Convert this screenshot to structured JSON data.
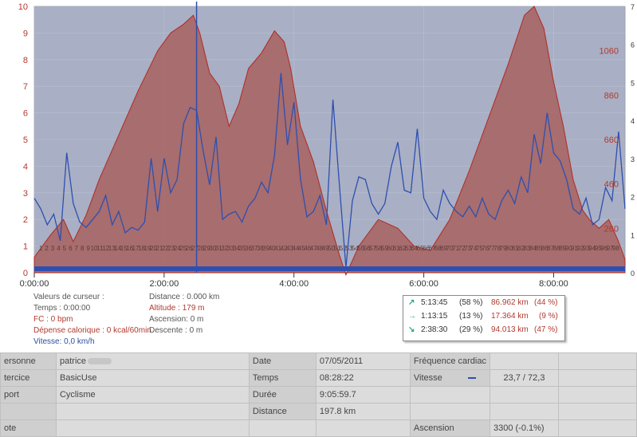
{
  "chart_data": {
    "type": "area",
    "x_ticks": [
      "0:00:00",
      "2:00:00",
      "4:00:00",
      "6:00:00",
      "8:00:00"
    ],
    "y_left_ticks": [
      "0",
      "1",
      "2",
      "3",
      "4",
      "5",
      "6",
      "7",
      "8",
      "9",
      "10"
    ],
    "y_right_ticks": [
      "0",
      "1",
      "2",
      "3",
      "4",
      "5",
      "6",
      "7"
    ],
    "altitude_ticks": [
      "260",
      "460",
      "660",
      "860",
      "1060"
    ],
    "x_range_hours": [
      0,
      9.1
    ],
    "y_left_range": [
      0,
      10
    ],
    "altitude_range_m": [
      60,
      1260
    ],
    "cursor_time": "2:30:00",
    "km_markers": [
      "1",
      "2",
      "3",
      "4",
      "5",
      "6",
      "7",
      "8",
      "9",
      "10",
      "11",
      "12",
      "13",
      "14",
      "15",
      "16",
      "17",
      "18",
      "19",
      "20",
      "21",
      "22",
      "23",
      "24",
      "25",
      "26",
      "27",
      "28",
      "29",
      "30",
      "31",
      "32",
      "33",
      "34",
      "35",
      "36",
      "37",
      "38",
      "39",
      "40",
      "41",
      "42",
      "43",
      "44",
      "45",
      "46",
      "47",
      "48",
      "49",
      "50",
      "51",
      "52",
      "53",
      "54",
      "55",
      "56",
      "57",
      "58",
      "59",
      "60",
      "61",
      "62",
      "63",
      "64",
      "65",
      "66",
      "67",
      "68",
      "69",
      "70",
      "71",
      "72",
      "73",
      "74",
      "75",
      "76",
      "77",
      "78",
      "79",
      "80",
      "81",
      "82",
      "83",
      "84",
      "85",
      "86",
      "87",
      "88",
      "89",
      "90",
      "91",
      "92",
      "93",
      "94",
      "95",
      "96",
      "97",
      "98"
    ],
    "altitude_series": {
      "x": [
        0,
        0.25,
        0.45,
        0.6,
        0.8,
        1.0,
        1.3,
        1.6,
        1.9,
        2.1,
        2.3,
        2.45,
        2.55,
        2.7,
        2.85,
        3.0,
        3.15,
        3.3,
        3.5,
        3.7,
        3.85,
        3.95,
        4.1,
        4.3,
        4.5,
        4.7,
        4.8,
        5.0,
        5.3,
        5.6,
        5.85,
        6.1,
        6.4,
        6.7,
        7.0,
        7.3,
        7.55,
        7.7,
        7.85,
        8.0,
        8.15,
        8.3,
        8.45,
        8.55,
        8.7,
        8.85,
        9.0,
        9.1
      ],
      "altitude_m": [
        130,
        230,
        300,
        200,
        320,
        480,
        680,
        880,
        1060,
        1140,
        1180,
        1220,
        1140,
        960,
        900,
        720,
        820,
        980,
        1050,
        1150,
        1100,
        980,
        720,
        560,
        340,
        140,
        50,
        180,
        300,
        260,
        180,
        160,
        300,
        520,
        760,
        1000,
        1220,
        1260,
        1160,
        920,
        720,
        480,
        340,
        300,
        260,
        300,
        200,
        120
      ]
    },
    "speed_series": {
      "x": [
        0,
        0.1,
        0.2,
        0.3,
        0.4,
        0.5,
        0.6,
        0.7,
        0.8,
        0.9,
        1.0,
        1.1,
        1.2,
        1.3,
        1.4,
        1.5,
        1.6,
        1.7,
        1.8,
        1.9,
        2.0,
        2.1,
        2.2,
        2.3,
        2.4,
        2.5,
        2.6,
        2.7,
        2.8,
        2.9,
        3.0,
        3.1,
        3.2,
        3.3,
        3.4,
        3.5,
        3.6,
        3.7,
        3.8,
        3.9,
        4.0,
        4.1,
        4.2,
        4.3,
        4.4,
        4.5,
        4.6,
        4.7,
        4.8,
        4.9,
        5.0,
        5.1,
        5.2,
        5.3,
        5.4,
        5.5,
        5.6,
        5.7,
        5.8,
        5.9,
        6.0,
        6.1,
        6.2,
        6.3,
        6.4,
        6.5,
        6.6,
        6.7,
        6.8,
        6.9,
        7.0,
        7.1,
        7.2,
        7.3,
        7.4,
        7.5,
        7.6,
        7.7,
        7.8,
        7.9,
        8.0,
        8.1,
        8.2,
        8.3,
        8.4,
        8.5,
        8.6,
        8.7,
        8.8,
        8.9,
        9.0,
        9.1
      ],
      "values": [
        2.8,
        2.4,
        1.8,
        2.2,
        1.2,
        4.5,
        2.6,
        1.9,
        1.7,
        2.0,
        2.3,
        2.9,
        1.8,
        2.3,
        1.5,
        1.7,
        1.6,
        1.9,
        4.3,
        2.3,
        4.3,
        3.0,
        3.5,
        5.6,
        6.2,
        6.1,
        4.6,
        3.3,
        5.1,
        2.0,
        2.2,
        2.3,
        1.9,
        2.5,
        2.8,
        3.4,
        3.0,
        4.4,
        7.5,
        4.8,
        6.4,
        3.5,
        2.1,
        2.3,
        2.9,
        1.8,
        6.5,
        3.3,
        0.2,
        2.7,
        3.6,
        3.5,
        2.6,
        2.2,
        2.6,
        4.0,
        4.9,
        3.1,
        3.0,
        5.4,
        2.8,
        2.3,
        2.0,
        3.1,
        2.6,
        2.3,
        2.1,
        2.5,
        2.1,
        2.8,
        2.2,
        2.0,
        2.7,
        3.1,
        2.6,
        3.6,
        3.0,
        5.2,
        4.1,
        6.0,
        4.5,
        4.2,
        3.5,
        2.4,
        2.2,
        2.8,
        1.8,
        2.0,
        3.2,
        2.7,
        5.3,
        2.4
      ]
    }
  },
  "cursor_info": {
    "title": "Valeurs de curseur :",
    "temps": "Temps : 0:00:00",
    "fc": "FC : 0 bpm",
    "depense": "Dépense calorique : 0 kcal/60min",
    "vitesse": "Vitesse: 0,0 km/h",
    "distance": "Distance : 0.000 km",
    "altitude": "Altitude : 179 m",
    "ascension": "Ascension: 0 m",
    "descente": "Descente : 0 m"
  },
  "summary": {
    "colors": {
      "arrow": "#2aa58c",
      "pct_km": "#b03a2e"
    },
    "rows": [
      {
        "icon": "arrow-up-right-icon",
        "arrow": "↗",
        "time": "5:13:45",
        "pct": "(58 %)",
        "km": "86.962 km",
        "kpct": "(44 %)"
      },
      {
        "icon": "arrow-right-icon",
        "arrow": "→",
        "time": "1:13:15",
        "pct": "(13 %)",
        "km": "17.364 km",
        "kpct": "(9 %)"
      },
      {
        "icon": "arrow-down-right-icon",
        "arrow": "↘",
        "time": "2:38:30",
        "pct": "(29 %)",
        "km": "94.013 km",
        "kpct": "(47 %)"
      }
    ]
  },
  "info_table": {
    "personne_label": "ersonne",
    "personne_value": "patrice",
    "exercice_label": "tercice",
    "exercice_value": "BasicUse",
    "sport_label": "port",
    "sport_value": "Cyclisme",
    "note_label": "ote",
    "date_label": "Date",
    "date_value": "07/05/2011",
    "temps_label": "Temps",
    "temps_value": "08:28:22",
    "duree_label": "Durée",
    "duree_value": "9:05:59.7",
    "distance_label": "Distance",
    "distance_value": "197.8 km",
    "fc_label": "Fréquence cardiac",
    "vitesse_label": "Vitesse",
    "vitesse_value": "23,7 / 72,3",
    "ascension_label": "Ascension",
    "ascension_value": "3300 (-0.1%)"
  }
}
